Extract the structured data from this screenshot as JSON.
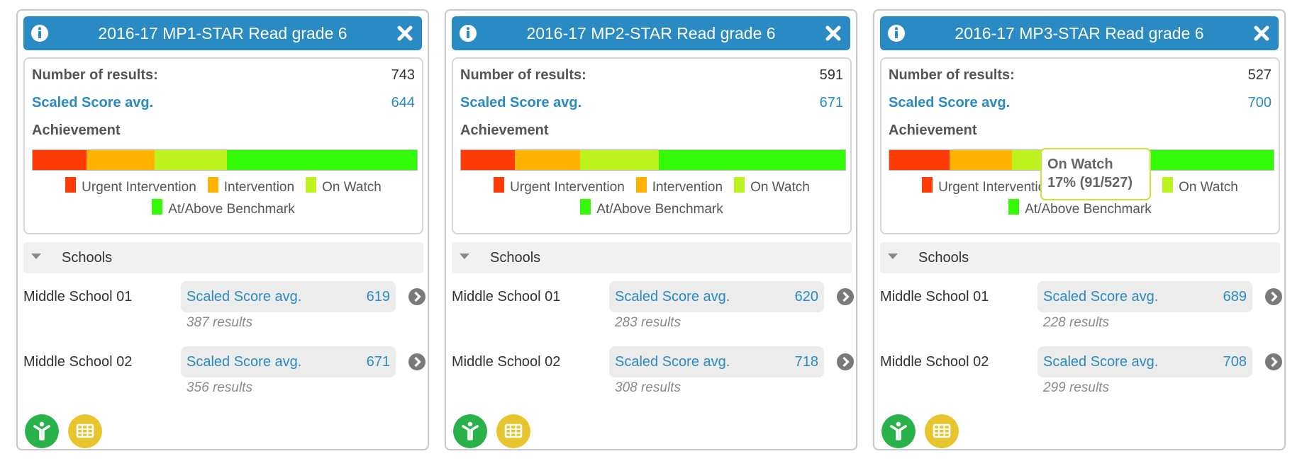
{
  "colors": {
    "header_bg": "#2a8ac3",
    "urgent": "#ff3c08",
    "intervention": "#ffb300",
    "on_watch": "#bef21e",
    "benchmark": "#33fb07",
    "student_button": "#29b14a",
    "table_button": "#e7c52e"
  },
  "labels": {
    "number_of_results": "Number of results:",
    "scaled_score_avg": "Scaled Score avg.",
    "achievement": "Achievement",
    "schools": "Schools"
  },
  "legend": [
    {
      "key": "urgent",
      "label": "Urgent Intervention"
    },
    {
      "key": "intervention",
      "label": "Intervention"
    },
    {
      "key": "on_watch",
      "label": "On Watch"
    },
    {
      "key": "benchmark",
      "label": "At/Above Benchmark"
    }
  ],
  "icons": {
    "info": "info-icon",
    "close": "close-icon",
    "collapse": "caret-down-icon",
    "go": "chevron-right-circle-icon",
    "student": "student-icon",
    "table": "table-icon"
  },
  "cards": [
    {
      "title": "2016-17 MP1-STAR Read grade 6",
      "number_of_results": "743",
      "scaled_score_avg": "644",
      "achievement": {
        "urgent": 14.1,
        "intervention": 17.6,
        "on_watch": 18.9,
        "benchmark": 49.4
      },
      "schools": [
        {
          "name": "Middle School 01",
          "score_label": "Scaled Score avg.",
          "score": "619",
          "results": "387 results"
        },
        {
          "name": "Middle School 02",
          "score_label": "Scaled Score avg.",
          "score": "671",
          "results": "356 results"
        }
      ]
    },
    {
      "title": "2016-17 MP2-STAR Read grade 6",
      "number_of_results": "591",
      "scaled_score_avg": "671",
      "achievement": {
        "urgent": 14.1,
        "intervention": 16.9,
        "on_watch": 20.4,
        "benchmark": 48.6
      },
      "schools": [
        {
          "name": "Middle School 01",
          "score_label": "Scaled Score avg.",
          "score": "620",
          "results": "283 results"
        },
        {
          "name": "Middle School 02",
          "score_label": "Scaled Score avg.",
          "score": "718",
          "results": "308 results"
        }
      ]
    },
    {
      "title": "2016-17 MP3-STAR Read grade 6",
      "number_of_results": "527",
      "scaled_score_avg": "700",
      "achievement": {
        "urgent": 15.6,
        "intervention": 16.3,
        "on_watch": 17.3,
        "benchmark": 50.8
      },
      "tooltip": {
        "title": "On Watch",
        "value": "17% (91/527)"
      },
      "schools": [
        {
          "name": "Middle School 01",
          "score_label": "Scaled Score avg.",
          "score": "689",
          "results": "228 results"
        },
        {
          "name": "Middle School 02",
          "score_label": "Scaled Score avg.",
          "score": "708",
          "results": "299 results"
        }
      ]
    }
  ]
}
